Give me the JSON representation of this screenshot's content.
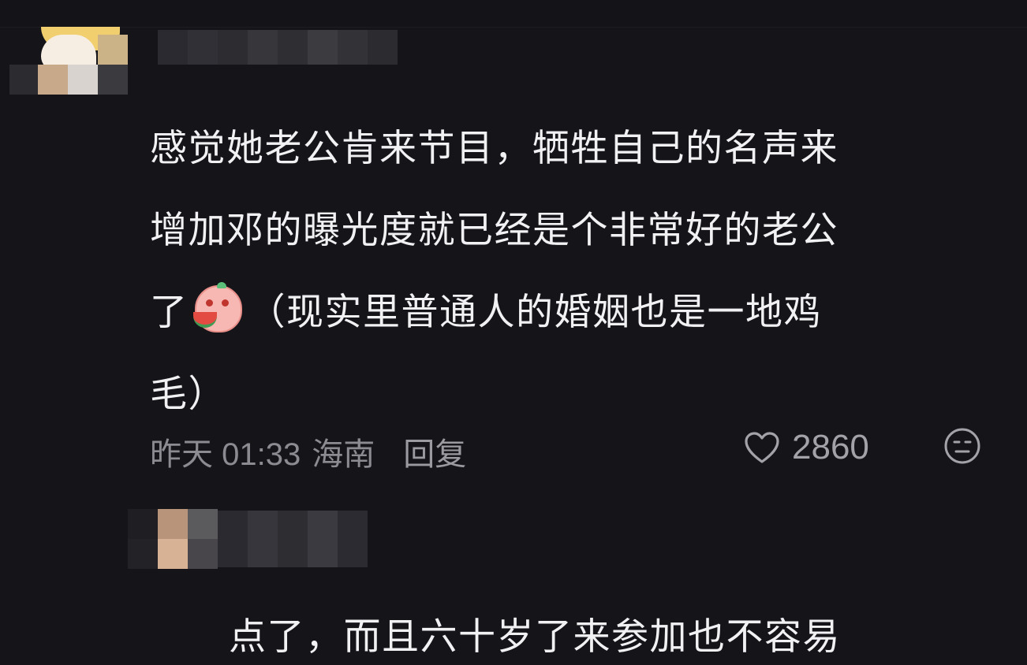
{
  "comments": [
    {
      "username": "",
      "text_line1": "感觉她老公肯来节目，牺牲自己的名声来",
      "text_line2": "增加邓的曝光度就已经是个非常好的老公",
      "text_line3_pre": "了",
      "emoji": "watermelon-eating-emoji",
      "text_line3_post": "（现实里普通人的婚姻也是一地鸡",
      "text_line4": "毛）",
      "time": "昨天 01:33",
      "location": "海南",
      "reply_label": "回复",
      "like_count": "2860"
    },
    {
      "username": "",
      "text_partial": "点了，而且六十岁了来参加也不容易"
    }
  ],
  "colors": {
    "background": "#141419",
    "text": "#f1f1f3",
    "meta": "#8b8b91"
  },
  "icons": {
    "like": "heart-outline-icon",
    "emotion": "neutral-face-icon"
  }
}
